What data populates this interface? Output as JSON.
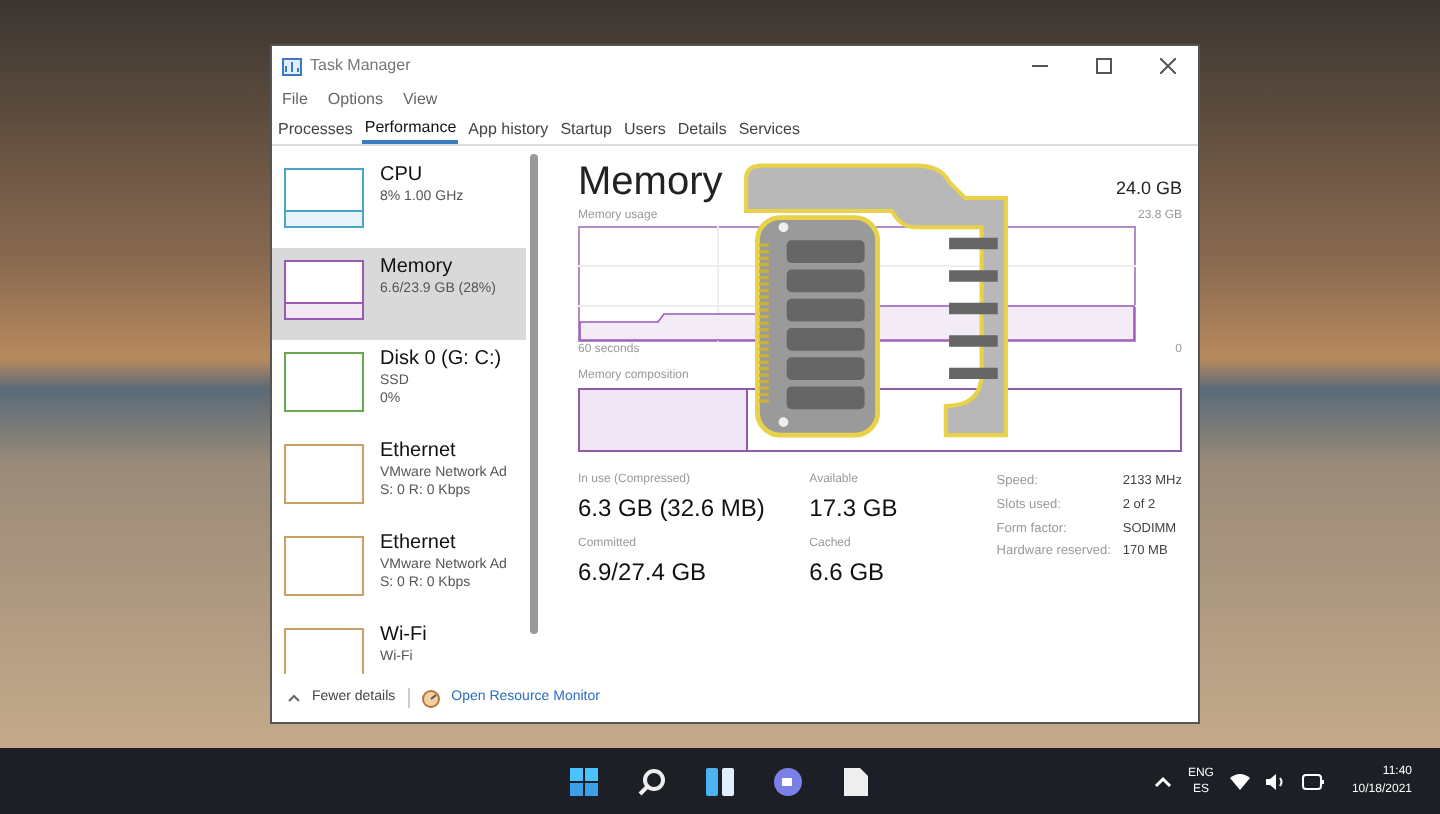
{
  "window": {
    "title": "Task Manager"
  },
  "menu": [
    "File",
    "Options",
    "View"
  ],
  "tabs": [
    {
      "label": "Processes",
      "selected": false
    },
    {
      "label": "Performance",
      "selected": true
    },
    {
      "label": "App history",
      "selected": false
    },
    {
      "label": "Startup",
      "selected": false
    },
    {
      "label": "Users",
      "selected": false
    },
    {
      "label": "Details",
      "selected": false
    },
    {
      "label": "Services",
      "selected": false
    }
  ],
  "sidebar": {
    "items": [
      {
        "title": "CPU",
        "lines": [
          "8%  1.00 GHz"
        ],
        "selected": false,
        "color": "#4aa3c8"
      },
      {
        "title": "Memory",
        "lines": [
          "6.6/23.9 GB (28%)"
        ],
        "selected": true,
        "color": "#9b59b6"
      },
      {
        "title": "Disk 0 (G: C:)",
        "lines": [
          "SSD",
          "0%"
        ],
        "selected": false,
        "color": "#6aa84f"
      },
      {
        "title": "Ethernet",
        "lines": [
          "VMware Network Ad",
          "S: 0 R: 0 Kbps"
        ],
        "selected": false,
        "color": "#c9a063"
      },
      {
        "title": "Ethernet",
        "lines": [
          "VMware Network Ad",
          "S: 0 R: 0 Kbps"
        ],
        "selected": false,
        "color": "#c9a063"
      },
      {
        "title": "Wi-Fi",
        "lines": [
          "Wi-Fi"
        ],
        "selected": false,
        "color": "#c9a063"
      }
    ]
  },
  "detail": {
    "title": "Memory",
    "total": "24.0 GB",
    "usage_label": "Memory usage",
    "usage_max": "23.8 GB",
    "usage_min": "0",
    "time_label": "60 seconds",
    "composition_label": "Memory composition",
    "stats": [
      {
        "label": "In use (Compressed)",
        "value": "6.3 GB (32.6 MB)"
      },
      {
        "label": "Available",
        "value": "17.3 GB"
      },
      {
        "label": "Committed",
        "value": "6.9/27.4 GB"
      },
      {
        "label": "Cached",
        "value": "6.6 GB"
      }
    ],
    "specs": [
      {
        "label": "Speed:",
        "value": "2133 MHz"
      },
      {
        "label": "Slots used:",
        "value": "2 of 2"
      },
      {
        "label": "Form factor:",
        "value": "SODIMM"
      },
      {
        "label": "Hardware reserved:",
        "value": "170 MB"
      }
    ]
  },
  "footer": {
    "fewer": "Fewer details",
    "monitor": "Open Resource Monitor"
  },
  "taskbar": {
    "lang": "ENG",
    "layout": "ES",
    "time": "11:40",
    "date": "10/18/2021"
  }
}
